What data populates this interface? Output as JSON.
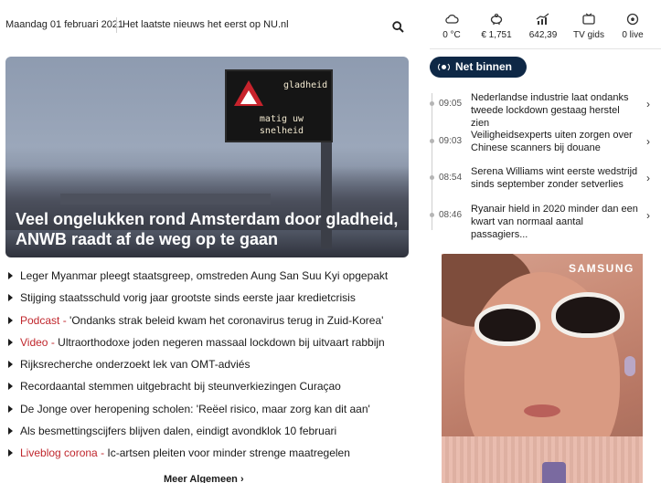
{
  "header": {
    "date": "Maandag 01 februari 2021",
    "tagline": "Het laatste nieuws het eerst op NU.nl"
  },
  "widgets": [
    {
      "icon": "weather-cloud-icon",
      "label": "0 °C"
    },
    {
      "icon": "piggy-bank-icon",
      "label": "€ 1,751"
    },
    {
      "icon": "stock-chart-icon",
      "label": "642,39"
    },
    {
      "icon": "tv-icon",
      "label": "TV gids"
    },
    {
      "icon": "football-icon",
      "label": "0 live"
    }
  ],
  "hero": {
    "title": "Veel ongelukken rond Amsterdam door gladheid, ANWB raadt af de weg op te gaan",
    "sign_line1": "gladheid",
    "sign_line2": "matig uw",
    "sign_line3": "snelheid"
  },
  "headlines": [
    {
      "label": "",
      "text": "Leger Myanmar pleegt staatsgreep, omstreden Aung San Suu Kyi opgepakt"
    },
    {
      "label": "",
      "text": "Stijging staatsschuld vorig jaar grootste sinds eerste jaar kredietcrisis"
    },
    {
      "label": "Podcast",
      "text": "'Ondanks strak beleid kwam het coronavirus terug in Zuid-Korea'"
    },
    {
      "label": "Video",
      "text": "Ultraorthodoxe joden negeren massaal lockdown bij uitvaart rabbijn"
    },
    {
      "label": "",
      "text": "Rijksrecherche onderzoekt lek van OMT-adviés"
    },
    {
      "label": "",
      "text": "Recordaantal stemmen uitgebracht bij steunverkiezingen Curaçao"
    },
    {
      "label": "",
      "text": "De Jonge over heropening scholen: 'Reëel risico, maar zorg kan dit aan'"
    },
    {
      "label": "",
      "text": "Als besmettingscijfers blijven dalen, eindigt avondklok 10 februari"
    },
    {
      "label": "Liveblog corona",
      "text": "Ic-artsen pleiten voor minder strenge maatregelen"
    }
  ],
  "more_link": "Meer Algemeen ›",
  "net_binnen": {
    "title": "Net binnen",
    "items": [
      {
        "time": "09:05",
        "text": "Nederlandse industrie laat ondanks tweede lockdown gestaag herstel zien"
      },
      {
        "time": "09:03",
        "text": "Veiligheidsexperts uiten zorgen over Chinese scanners bij douane"
      },
      {
        "time": "08:54",
        "text": "Serena Williams wint eerste wedstrijd sinds september zonder setverlies"
      },
      {
        "time": "08:46",
        "text": "Ryanair hield in 2020 minder dan een kwart van normaal aantal passagiers..."
      }
    ]
  },
  "ad": {
    "brand": "SAMSUNG"
  },
  "colors": {
    "navy": "#0e2846",
    "label_red": "#c0272d"
  }
}
